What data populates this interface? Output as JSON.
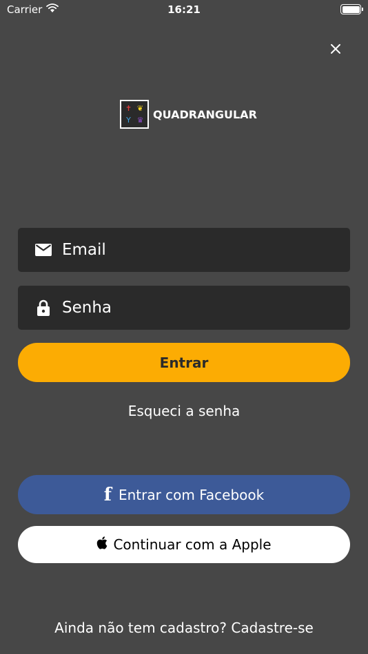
{
  "status_bar": {
    "carrier": "Carrier",
    "time": "16:21"
  },
  "logo": {
    "text": "QUADRANGULAR"
  },
  "login_form": {
    "email_placeholder": "Email",
    "password_placeholder": "Senha",
    "submit_label": "Entrar",
    "forgot_password": "Esqueci a senha"
  },
  "social": {
    "facebook_label": "Entrar com Facebook",
    "apple_label": "Continuar com a Apple"
  },
  "footer": {
    "signup_text": "Ainda não tem cadastro? Cadastre-se"
  },
  "colors": {
    "background": "#474747",
    "field_background": "#2a2a2a",
    "primary": "#fcac03",
    "facebook": "#3d5a98"
  }
}
